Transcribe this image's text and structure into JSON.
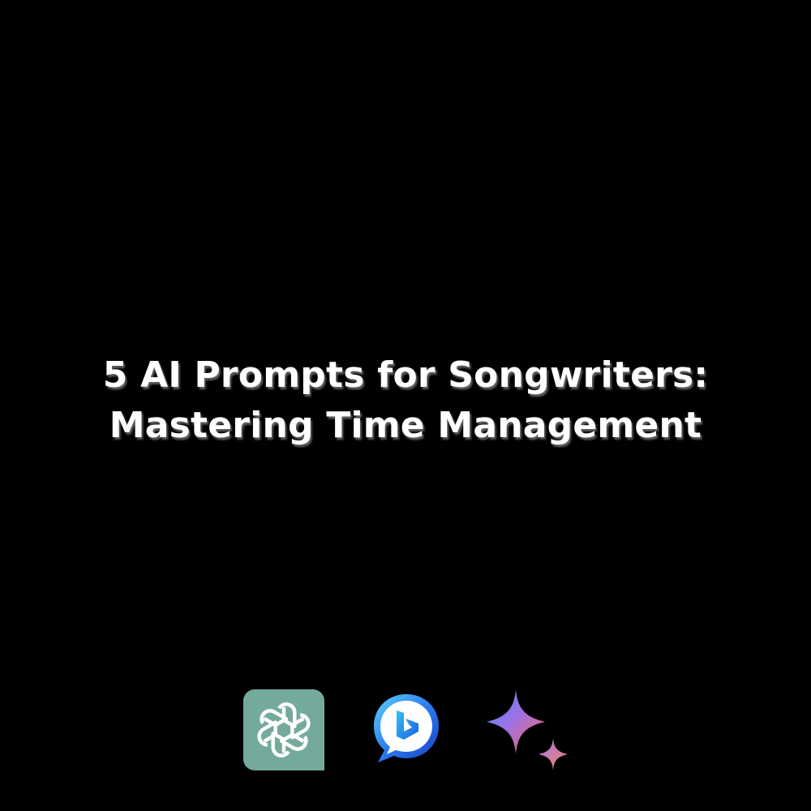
{
  "headline": {
    "line1": "5 AI Prompts for Songwriters:",
    "line2": "Mastering Time Management"
  },
  "logos": [
    {
      "icon": "openai-logo-icon",
      "color": "#74aa9c"
    },
    {
      "icon": "bing-chat-logo-icon",
      "color": "#1b6ef3"
    },
    {
      "icon": "gemini-sparkle-logo-icon",
      "color": "#8a6ee8"
    }
  ],
  "colors": {
    "background": "#000000",
    "text": "#ffffff"
  }
}
